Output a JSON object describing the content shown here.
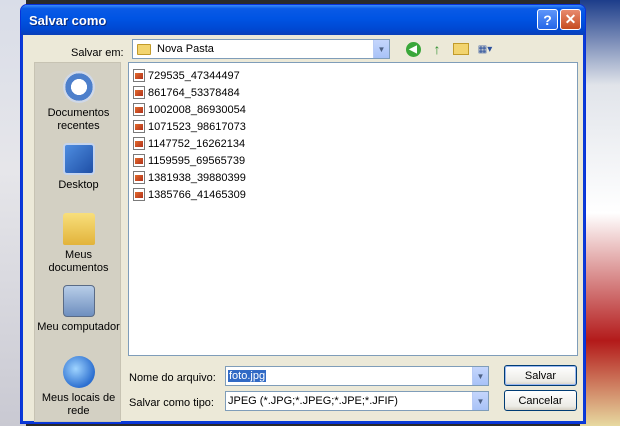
{
  "window": {
    "title": "Salvar como"
  },
  "title_buttons": {
    "help": "?",
    "close": "✕"
  },
  "save_in": {
    "label": "Salvar em:",
    "value": "Nova Pasta"
  },
  "places": [
    {
      "label": "Documentos recentes",
      "icon": "recent-documents-icon"
    },
    {
      "label": "Desktop",
      "icon": "desktop-icon"
    },
    {
      "label": "Meus documentos",
      "icon": "my-documents-icon"
    },
    {
      "label": "Meu computador",
      "icon": "my-computer-icon"
    },
    {
      "label": "Meus locais de rede",
      "icon": "network-places-icon"
    }
  ],
  "files": [
    "729535_47344497",
    "861764_53378484",
    "1002008_86930054",
    "1071523_98617073",
    "1147752_16262134",
    "1159595_69565739",
    "1381938_39880399",
    "1385766_41465309"
  ],
  "filename": {
    "label": "Nome do arquivo:",
    "value": "foto.jpg"
  },
  "filetype": {
    "label": "Salvar como tipo:",
    "value": "JPEG (*.JPG;*.JPEG;*.JPE;*.JFIF)"
  },
  "buttons": {
    "save": "Salvar",
    "cancel": "Cancelar"
  },
  "colors": {
    "titlebar": "#0054e3",
    "dialog_bg": "#ece9d8",
    "selection": "#316ac5"
  }
}
